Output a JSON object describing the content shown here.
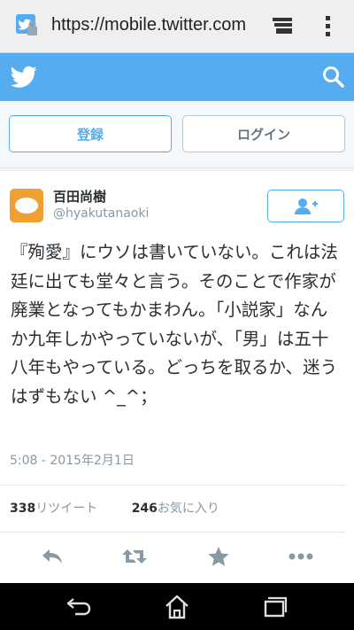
{
  "browser": {
    "url": "https://mobile.twitter.com"
  },
  "header": {
    "logo_icon": "twitter-bird-icon",
    "search_icon": "search-icon"
  },
  "auth": {
    "signup_label": "登録",
    "login_label": "ログイン"
  },
  "tweet": {
    "display_name": "百田尚樹",
    "screen_name": "@hyakutanaoki",
    "text": "『殉愛』にウソは書いていない。これは法廷に出ても堂々と言う。そのことで作家が廃業となってもかまわん。「小説家」なんか九年しかやっていないが、「男」は五十八年もやっている。どっちを取るか、迷うはずもない ^_^；",
    "timestamp": "5:08 - 2015年2月1日",
    "retweets": {
      "count": "338",
      "label": "リツイート"
    },
    "favorites": {
      "count": "246",
      "label": "お気に入り"
    }
  },
  "colors": {
    "brand": "#55acee",
    "muted": "#8899a6",
    "text": "#292f33"
  }
}
